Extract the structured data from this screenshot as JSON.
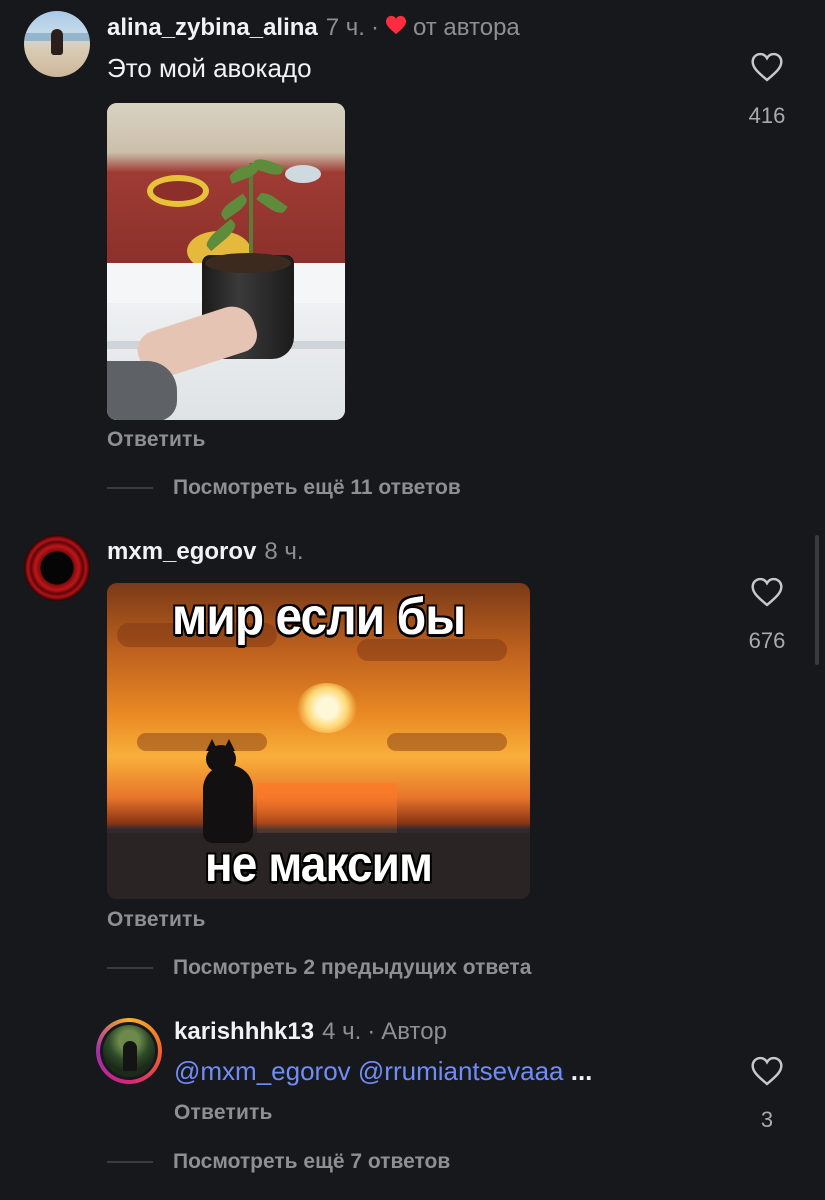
{
  "comments": [
    {
      "username": "alina_zybina_alina",
      "time": "7 ч.",
      "separator": "·",
      "author_like": "от автора",
      "text": "Это мой авокадо",
      "likes": "416",
      "reply_label": "Ответить",
      "more_replies": "Посмотреть ещё 11 ответов"
    },
    {
      "username": "mxm_egorov",
      "time": "8 ч.",
      "meme_top": "мир если бы",
      "meme_bottom": "не максим",
      "likes": "676",
      "reply_label": "Ответить",
      "previous_replies": "Посмотреть 2 предыдущих ответа"
    }
  ],
  "reply": {
    "username": "karishhhk13",
    "time": "4 ч.",
    "separator": "·",
    "author_badge": "Автор",
    "mention1": "@mxm_egorov",
    "mention2": "@rrumiantsevaaa",
    "ellipsis": "...",
    "likes": "3",
    "reply_label": "Ответить",
    "more_replies": "Посмотреть ещё 7 ответов"
  },
  "colors": {
    "background": "#17181c",
    "mention": "#6f8df5",
    "heart": "#ff2d3d",
    "muted": "#8e8e93"
  }
}
